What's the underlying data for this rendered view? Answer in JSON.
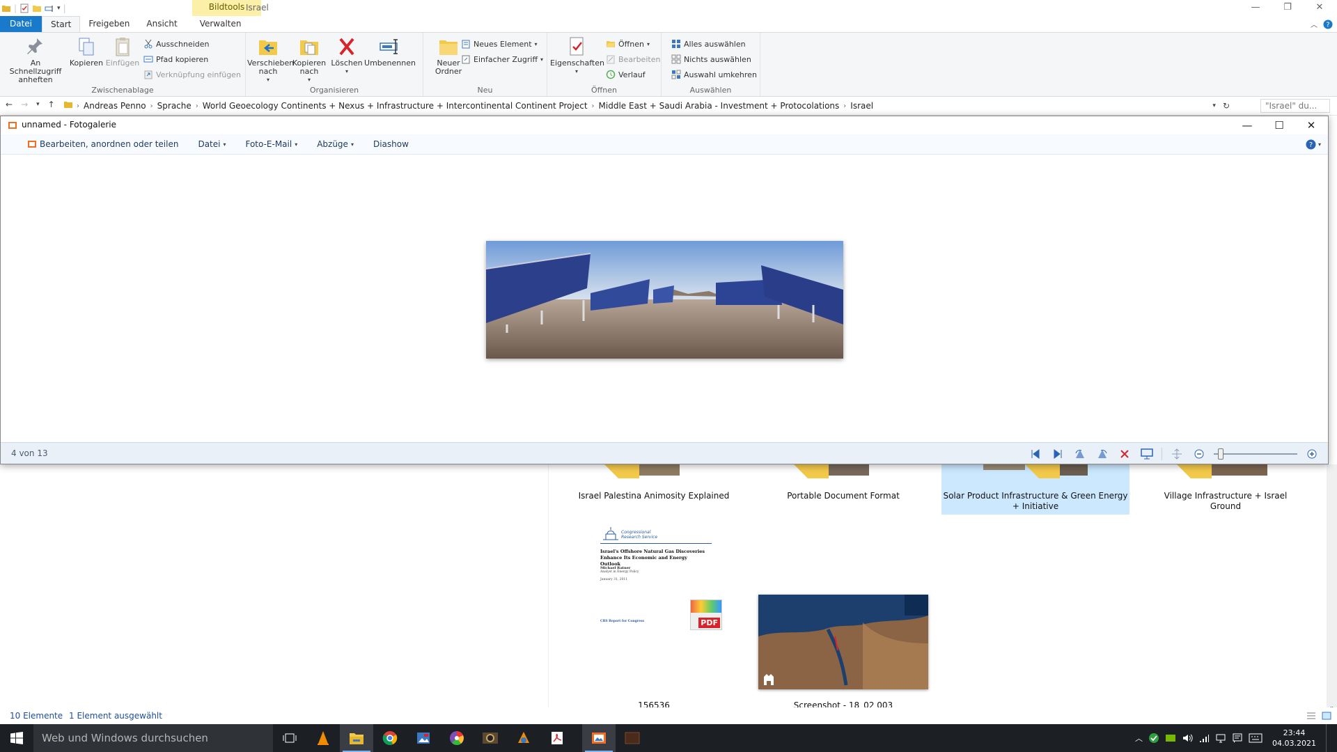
{
  "explorer": {
    "contextual_tab": "Bildtools",
    "window_name": "Israel",
    "tabs": [
      {
        "label": "Datei"
      },
      {
        "label": "Start"
      },
      {
        "label": "Freigeben"
      },
      {
        "label": "Ansicht"
      },
      {
        "label": "Verwalten"
      }
    ],
    "ribbon": {
      "clipboard": {
        "group": "Zwischenablage",
        "pin": "An Schnellzugriff anheften",
        "copy": "Kopieren",
        "paste": "Einfügen",
        "cut": "Ausschneiden",
        "copy_path": "Pfad kopieren",
        "paste_shortcut": "Verknüpfung einfügen"
      },
      "organize": {
        "group": "Organisieren",
        "move_to": "Verschieben nach",
        "copy_to": "Kopieren nach",
        "delete": "Löschen",
        "rename": "Umbenennen"
      },
      "new": {
        "group": "Neu",
        "new_folder": "Neuer Ordner",
        "new_item": "Neues Element",
        "easy_access": "Einfacher Zugriff"
      },
      "open": {
        "group": "Öffnen",
        "properties": "Eigenschaften",
        "open": "Öffnen",
        "edit": "Bearbeiten",
        "history": "Verlauf"
      },
      "select": {
        "group": "Auswählen",
        "select_all": "Alles auswählen",
        "select_none": "Nichts auswählen",
        "invert": "Auswahl umkehren"
      }
    },
    "breadcrumbs": [
      "Andreas Penno",
      "Sprache",
      "World Geoecology Continents + Nexus + Infrastructure + Intercontinental Continent Project",
      "Middle East + Saudi Arabia - Investment + Protocolations",
      "Israel"
    ],
    "search_placeholder": "\"Israel\" du...",
    "items": [
      {
        "label": "Israel Palestina Animosity Explained"
      },
      {
        "label": "Portable Document Format"
      },
      {
        "label": "Solar Product Infrastructure & Green Energy + Initiative"
      },
      {
        "label": "Village Infrastructure + Israel Ground"
      },
      {
        "label": "156536"
      },
      {
        "label": "Screenshot - 18_02 003"
      }
    ],
    "pdf_thumb": {
      "org": "Congressional Research Service",
      "title": "Israel's Offshore Natural Gas Discoveries Enhance Its Economic and Energy Outlook",
      "author": "Michael Ratner",
      "author_role": "Analyst in Energy Policy",
      "date": "January 31, 2011",
      "footer": "CRS Report for Congress",
      "badge": "PDF"
    },
    "status": {
      "count": "10 Elemente",
      "selected": "1 Element ausgewählt"
    }
  },
  "gallery": {
    "title": "unnamed - Fotogalerie",
    "menu": {
      "edit": "Bearbeiten, anordnen oder teilen",
      "file": "Datei",
      "email": "Foto-E-Mail",
      "prints": "Abzüge",
      "slideshow": "Diashow"
    },
    "position": "4 von 13",
    "zoom_fraction": 0.05
  },
  "taskbar": {
    "search_placeholder": "Web und Windows durchsuchen",
    "time": "23:44",
    "date": "04.03.2021"
  }
}
